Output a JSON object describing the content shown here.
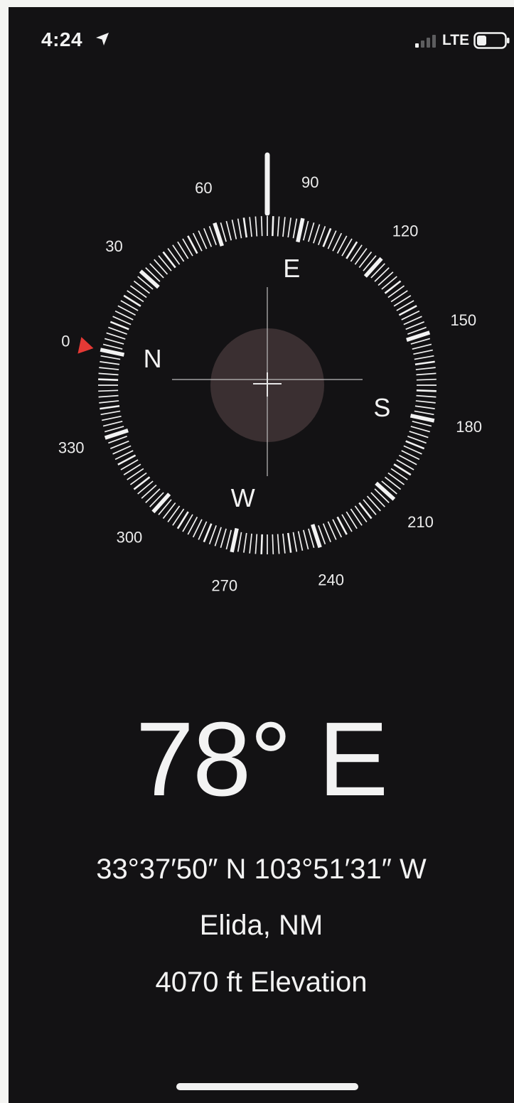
{
  "status_bar": {
    "time": "4:24",
    "network": "LTE"
  },
  "compass": {
    "heading_degrees": 78,
    "degree_labels": [
      "0",
      "30",
      "60",
      "90",
      "120",
      "150",
      "180",
      "210",
      "240",
      "270",
      "300",
      "330"
    ],
    "cardinals": {
      "north": "N",
      "east": "E",
      "south": "S",
      "west": "W"
    },
    "colors": {
      "background": "#131214",
      "ring": "#f3f3f3",
      "north_marker": "#e53935",
      "center_disc": "#3a2f31"
    }
  },
  "readout": {
    "heading": "78° E",
    "coordinates": "33°37′50″ N  103°51′31″ W",
    "location": "Elida, NM",
    "elevation": "4070 ft Elevation"
  }
}
